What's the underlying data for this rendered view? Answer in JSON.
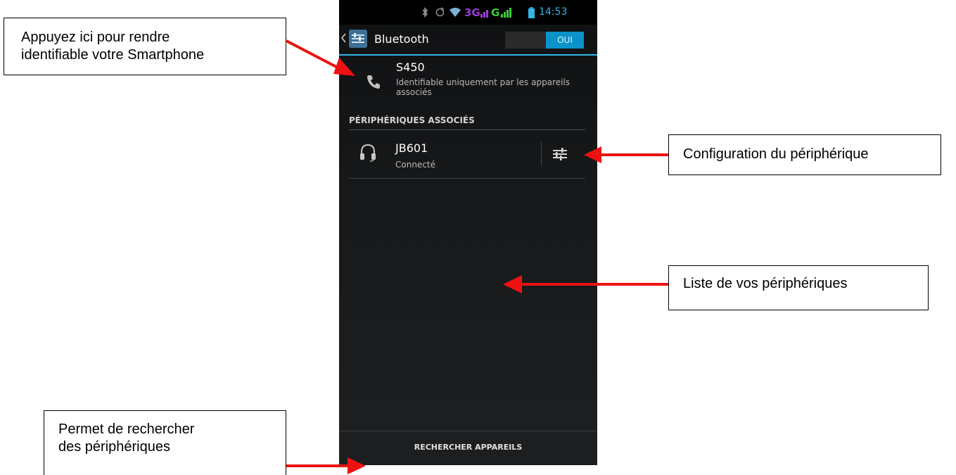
{
  "callouts": {
    "visibility": [
      "Appuyez ici pour rendre",
      "identifiable votre Smartphone"
    ],
    "config": "Configuration du périphérique",
    "list": "Liste de vos périphériques",
    "search": [
      "Permet de rechercher",
      "des périphériques"
    ]
  },
  "status_bar": {
    "network_3g": "3G",
    "network_g": "G",
    "time": "14:53"
  },
  "action_bar": {
    "title": "Bluetooth",
    "toggle_on": "OUI"
  },
  "this_device": {
    "name": "S450",
    "status": "Identifiable uniquement par les appareils associés"
  },
  "paired": {
    "section_title": "PÉRIPHÉRIQUES ASSOCIÉS",
    "devices": [
      {
        "name": "JB601",
        "status": "Connecté"
      }
    ]
  },
  "bottom": {
    "scan_label": "RECHERCHER APPAREILS"
  },
  "colors": {
    "accent": "#33b5e5",
    "annotation_arrow": "#ee1111",
    "network_3g": "#9b3bd6",
    "network_g": "#3ccc3c"
  },
  "icons": [
    "bluetooth-icon",
    "sync-icon",
    "wifi-icon",
    "signal-icon",
    "battery-icon",
    "back-chevron-icon",
    "settings-app-icon",
    "phone-icon",
    "headset-icon",
    "settings-sliders-icon"
  ]
}
